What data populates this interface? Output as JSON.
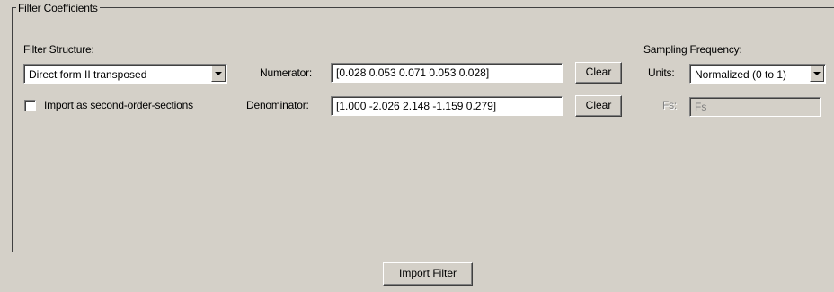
{
  "group": {
    "title": "Filter Coefficients"
  },
  "structure": {
    "label": "Filter Structure:",
    "selected": "Direct form II transposed",
    "checkbox_label": "Import as second-order-sections",
    "checkbox_checked": false
  },
  "coefficients": {
    "numerator_label": "Numerator:",
    "numerator_value": "[0.028  0.053 0.071  0.053 0.028]",
    "denominator_label": "Denominator:",
    "denominator_value": "[1.000 -2.026 2.148 -1.159 0.279]",
    "clear_label": "Clear"
  },
  "sampling": {
    "title": "Sampling Frequency:",
    "units_label": "Units:",
    "units_selected": "Normalized (0 to 1)",
    "fs_label": "Fs:",
    "fs_value": "Fs"
  },
  "footer": {
    "import_label": "Import Filter"
  }
}
